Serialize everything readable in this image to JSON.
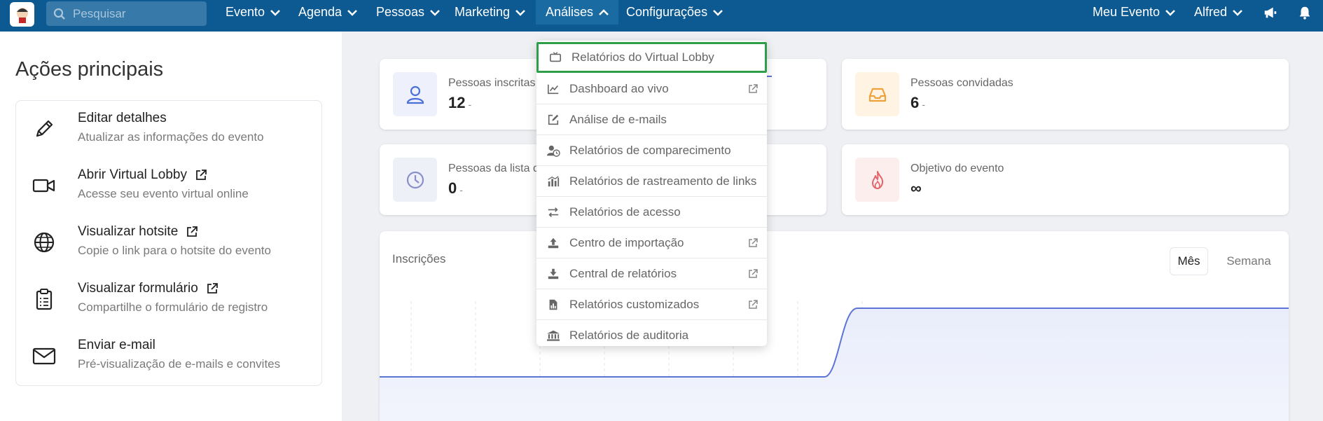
{
  "nav": {
    "search_placeholder": "Pesquisar",
    "items": [
      "Evento",
      "Agenda",
      "Pessoas",
      "Marketing",
      "Análises",
      "Configurações"
    ],
    "right_items": [
      "Meu Evento",
      "Alfred"
    ],
    "icons": [
      "megaphone-icon",
      "bell-icon"
    ]
  },
  "left": {
    "title": "Ações principais",
    "actions": [
      {
        "title": "Editar detalhes",
        "desc": "Atualizar as informações do evento",
        "icon": "pencil-icon",
        "external": false
      },
      {
        "title": "Abrir Virtual Lobby",
        "desc": "Acesse seu evento virtual online",
        "icon": "video-camera-icon",
        "external": true
      },
      {
        "title": "Visualizar hotsite",
        "desc": "Copie o link para o hotsite do evento",
        "icon": "globe-icon",
        "external": true
      },
      {
        "title": "Visualizar formulário",
        "desc": "Compartilhe o formulário de registro",
        "icon": "clipboard-icon",
        "external": true
      },
      {
        "title": "Enviar e-mail",
        "desc": "Pré-visualização de e-mails e convites",
        "icon": "envelope-icon",
        "external": false
      }
    ]
  },
  "stats": [
    {
      "label": "Pessoas inscritas",
      "value": "12",
      "suffix": "-",
      "icon": "user-icon",
      "color": "#4a6fd8"
    },
    {
      "label": "Pessoas convidadas",
      "value": "6",
      "suffix": "-",
      "icon": "inbox-icon",
      "color": "#f0a23a"
    },
    {
      "label": "Pessoas da lista d",
      "value": "0",
      "suffix": "-",
      "icon": "clock-icon",
      "color": "#8a8fc9"
    },
    {
      "label": "Objetivo do evento",
      "value": "∞",
      "suffix": "",
      "icon": "flame-icon",
      "color": "#e5646b"
    }
  ],
  "chart": {
    "title": "Inscrições",
    "segments": [
      "Mês",
      "Semana"
    ],
    "active_segment": "Mês"
  },
  "dropdown": {
    "items": [
      {
        "label": "Relatórios do Virtual Lobby",
        "icon": "tv-icon",
        "external": false,
        "highlight": true
      },
      {
        "label": "Dashboard ao vivo",
        "icon": "line-chart-icon",
        "external": true
      },
      {
        "label": "Análise de e-mails",
        "icon": "edit-icon",
        "external": false
      },
      {
        "label": "Relatórios de comparecimento",
        "icon": "user-clock-icon",
        "external": false
      },
      {
        "label": "Relatórios de rastreamento de links",
        "icon": "bar-chart-icon",
        "external": false
      },
      {
        "label": "Relatórios de acesso",
        "icon": "exchange-icon",
        "external": false
      },
      {
        "label": "Centro de importação",
        "icon": "upload-icon",
        "external": true
      },
      {
        "label": "Central de relatórios",
        "icon": "download-icon",
        "external": true
      },
      {
        "label": "Relatórios customizados",
        "icon": "file-chart-icon",
        "external": true
      },
      {
        "label": "Relatórios de auditoria",
        "icon": "bank-icon",
        "external": false
      }
    ]
  },
  "colors": {
    "nav_bg": "#0d5a93",
    "accent_line": "#5b75d6",
    "highlight_border": "#2e9e4a"
  }
}
